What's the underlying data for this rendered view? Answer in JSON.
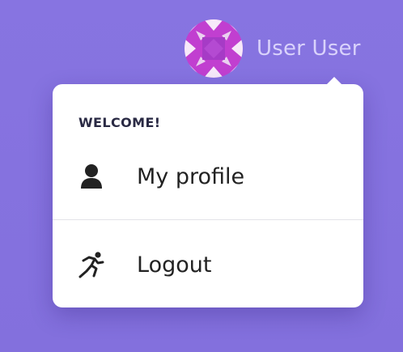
{
  "user": {
    "name": "User User",
    "avatar_icon": "avatar-pattern"
  },
  "menu": {
    "header": "WELCOME!",
    "items": [
      {
        "label": "My profile",
        "icon": "user-icon"
      },
      {
        "label": "Logout",
        "icon": "running-person-icon"
      }
    ]
  },
  "colors": {
    "background": "#8774e1",
    "user_name": "#d9d2fb",
    "avatar_bg": "#c13fd0",
    "avatar_center": "#a63bc6",
    "menu_bg": "#ffffff"
  }
}
